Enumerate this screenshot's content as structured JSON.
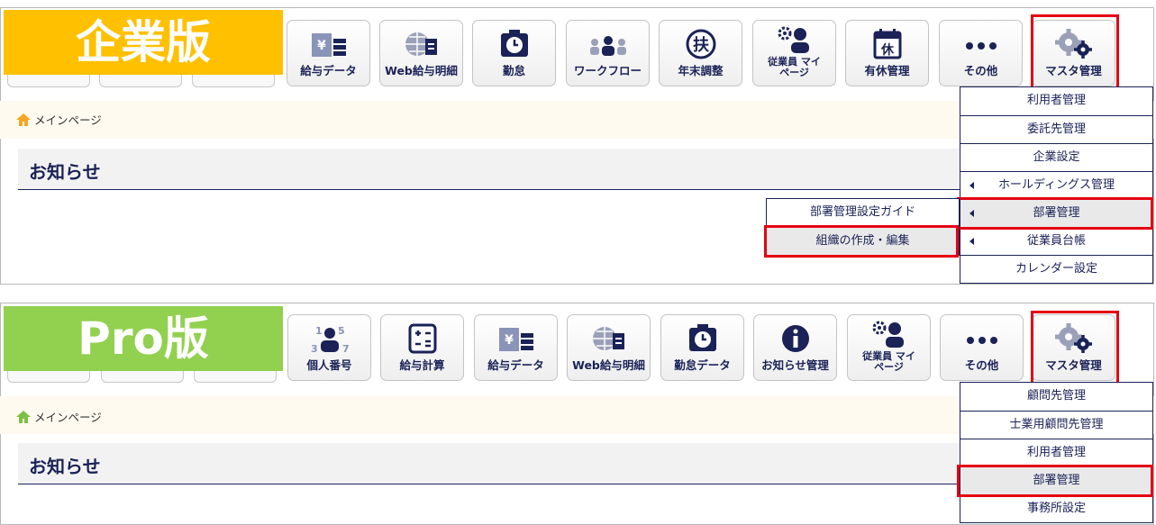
{
  "enterprise": {
    "edition_label": "企業版",
    "edition_color": "#ffc000",
    "nav": [
      {
        "label": "給与データ",
        "icon": "pay-data-icon"
      },
      {
        "label": "Web給与明細",
        "icon": "web-payslip-icon"
      },
      {
        "label": "勤怠",
        "icon": "attendance-icon"
      },
      {
        "label": "ワークフロー",
        "icon": "workflow-icon"
      },
      {
        "label": "年末調整",
        "icon": "year-end-adjustment-icon"
      },
      {
        "label": "従業員 マイページ",
        "icon": "employee-mypage-icon"
      },
      {
        "label": "有休管理",
        "icon": "paid-leave-icon"
      },
      {
        "label": "その他",
        "icon": "more-icon"
      },
      {
        "label": "マスタ管理",
        "icon": "gear-icon"
      }
    ],
    "breadcrumb": "メインページ",
    "notice_title": "お知らせ",
    "master_menu": [
      "利用者管理",
      "委託先管理",
      "企業設定",
      "ホールディングス管理",
      "部署管理",
      "従業員台帳",
      "カレンダー設定"
    ],
    "department_submenu": [
      "部署管理設定ガイド",
      "組織の作成・編集"
    ]
  },
  "pro": {
    "edition_label": "Pro版",
    "edition_color": "#92d050",
    "nav": [
      {
        "label": "個人番号",
        "icon": "my-number-icon"
      },
      {
        "label": "給与計算",
        "icon": "calculator-icon"
      },
      {
        "label": "給与データ",
        "icon": "pay-data-icon"
      },
      {
        "label": "Web給与明細",
        "icon": "web-payslip-icon"
      },
      {
        "label": "勤怠データ",
        "icon": "attendance-icon"
      },
      {
        "label": "お知らせ管理",
        "icon": "info-icon"
      },
      {
        "label": "従業員 マイページ",
        "icon": "employee-mypage-icon"
      },
      {
        "label": "その他",
        "icon": "more-icon"
      },
      {
        "label": "マスタ管理",
        "icon": "gear-icon"
      }
    ],
    "breadcrumb": "メインページ",
    "notice_title": "お知らせ",
    "master_menu": [
      "顧問先管理",
      "士業用顧問先管理",
      "利用者管理",
      "部署管理",
      "事務所設定"
    ]
  },
  "colors": {
    "navy": "#1a2257",
    "highlight": "#e50012",
    "home_orange": "#f5a623",
    "home_green": "#7cc242"
  }
}
